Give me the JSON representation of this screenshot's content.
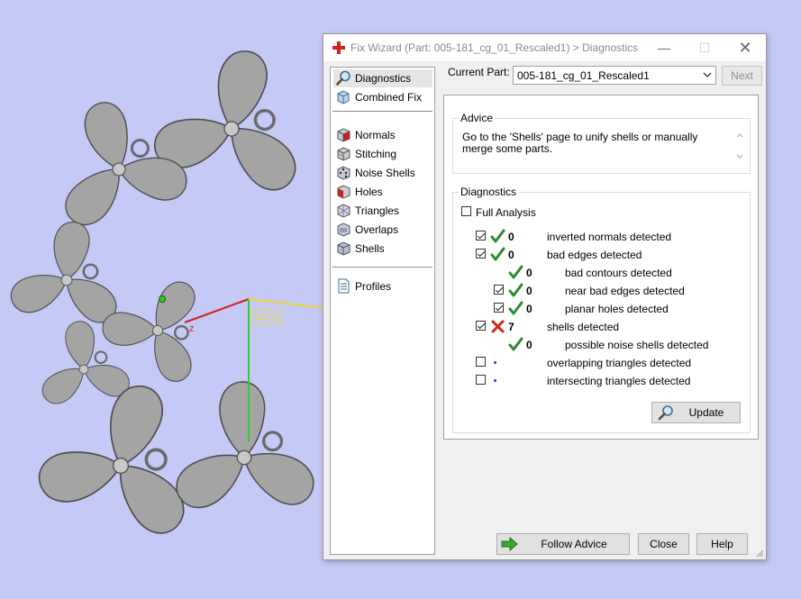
{
  "window": {
    "title": "Fix Wizard (Part: 005-181_cg_01_Rescaled1) > Diagnostics",
    "minimize_symbol": "—",
    "maximize_symbol": "☐",
    "close_symbol": "✕"
  },
  "viewport": {
    "axis_label": "WCS",
    "axis_x_label": "z",
    "background_color": "#c5c9f6"
  },
  "sidebar": {
    "items": [
      {
        "label": "Diagnostics",
        "icon": "magnifier-icon",
        "selected": true
      },
      {
        "label": "Combined Fix",
        "icon": "combined-fix-icon"
      },
      {
        "label": "Normals",
        "icon": "normals-cube-icon"
      },
      {
        "label": "Stitching",
        "icon": "stitching-cube-icon"
      },
      {
        "label": "Noise Shells",
        "icon": "noise-shells-cube-icon"
      },
      {
        "label": "Holes",
        "icon": "holes-cube-icon"
      },
      {
        "label": "Triangles",
        "icon": "triangles-cube-icon"
      },
      {
        "label": "Overlaps",
        "icon": "overlaps-cube-icon"
      },
      {
        "label": "Shells",
        "icon": "shells-cube-icon"
      },
      {
        "label": "Profiles",
        "icon": "profiles-document-icon"
      }
    ]
  },
  "current_part": {
    "label": "Current Part:",
    "value": "005-181_cg_01_Rescaled1",
    "next_label": "Next"
  },
  "advice": {
    "title": "Advice",
    "text": "Go to the 'Shells' page to unify shells or manually merge some parts."
  },
  "diagnostics": {
    "title": "Diagnostics",
    "full_analysis_label": "Full Analysis",
    "full_analysis_checked": false,
    "rows": [
      {
        "label": "inverted normals detected",
        "count": "0",
        "status": "ok",
        "checkbox": true,
        "checked": true
      },
      {
        "label": "bad edges detected",
        "count": "0",
        "status": "ok",
        "checkbox": true,
        "checked": true
      },
      {
        "label": "bad contours detected",
        "count": "0",
        "status": "ok",
        "checkbox": false,
        "checked": false
      },
      {
        "label": "near bad edges detected",
        "count": "0",
        "status": "ok",
        "checkbox": true,
        "checked": true
      },
      {
        "label": "planar holes detected",
        "count": "0",
        "status": "ok",
        "checkbox": true,
        "checked": true
      },
      {
        "label": "shells detected",
        "count": "7",
        "status": "error",
        "checkbox": true,
        "checked": true
      },
      {
        "label": "possible noise shells detected",
        "count": "0",
        "status": "ok",
        "checkbox": false,
        "checked": false
      },
      {
        "label": "overlapping triangles detected",
        "count": "",
        "status": "none",
        "checkbox": true,
        "checked": false
      },
      {
        "label": "intersecting triangles detected",
        "count": "",
        "status": "none",
        "checkbox": true,
        "checked": false
      }
    ],
    "update_label": "Update"
  },
  "buttons": {
    "follow_advice": "Follow Advice",
    "close": "Close",
    "help": "Help"
  },
  "colors": {
    "ok_green": "#2e8b2e",
    "error_red": "#cc2a1a",
    "dot_blue": "#1a3ab8",
    "axis_x": "#d22020",
    "axis_y": "#2ecc2e",
    "axis_z": "#e8d63a"
  }
}
